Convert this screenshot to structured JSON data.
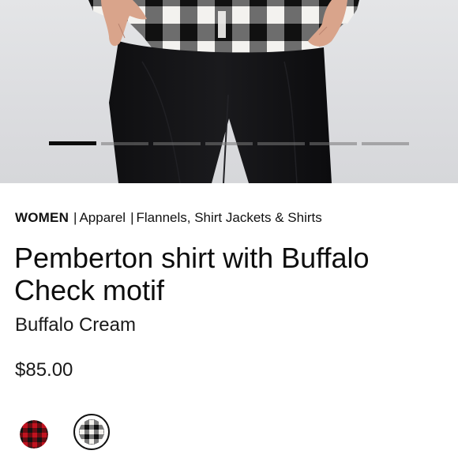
{
  "hero": {
    "alt_icon": "product-photo",
    "slides_count": 7,
    "active_slide": 1
  },
  "breadcrumb": {
    "items": [
      "WOMEN",
      "Apparel",
      "Flannels, Shirt Jackets & Shirts"
    ],
    "separator": "|"
  },
  "product": {
    "title": "Pemberton shirt with Buffalo Check motif",
    "color_name": "Buffalo Cream",
    "price": "$85.00"
  },
  "swatches": [
    {
      "name": "red-buffalo-check",
      "colors": [
        "#b3101b",
        "#111111"
      ],
      "selected": false
    },
    {
      "name": "buffalo-cream",
      "colors": [
        "#f4f2ee",
        "#111111"
      ],
      "selected": true
    }
  ],
  "colors": {
    "text": "#111111",
    "background": "#ffffff",
    "indicator_active": "#0b0b0b",
    "indicator_inactive": "#8a8a8a"
  }
}
